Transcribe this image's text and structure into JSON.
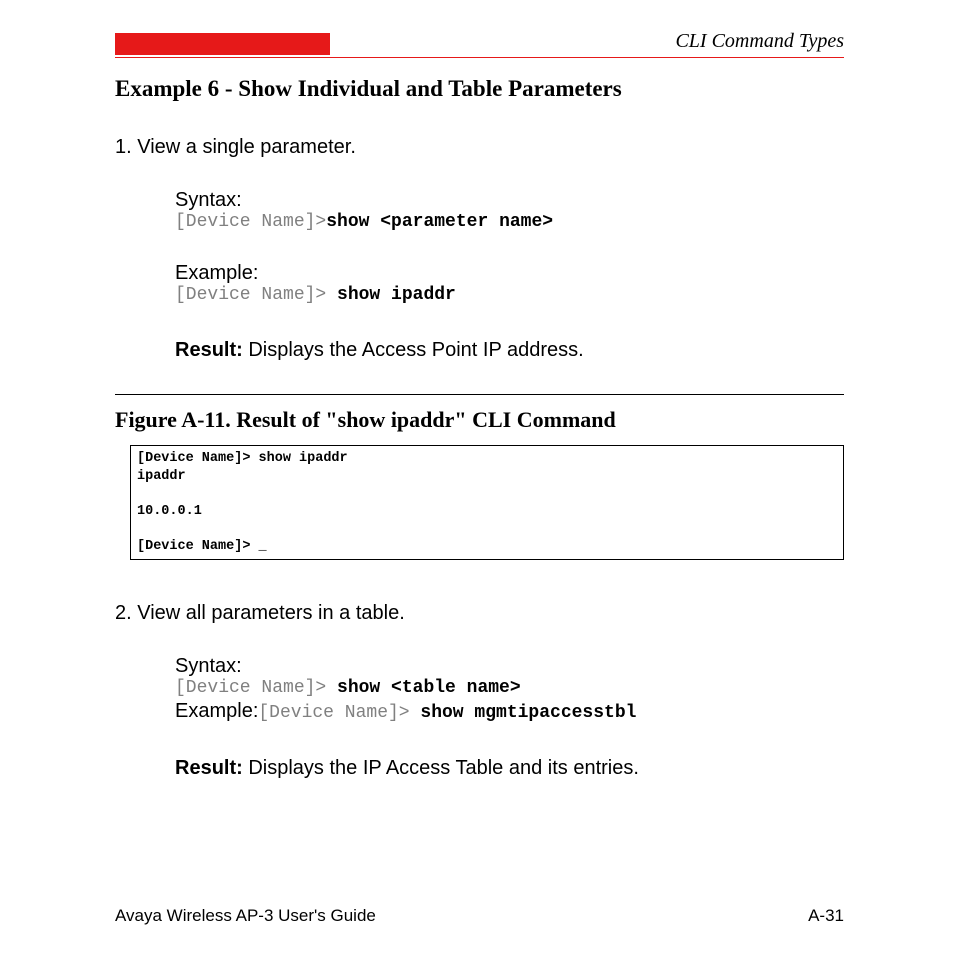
{
  "header": {
    "title": "CLI Command Types"
  },
  "heading": "Example 6 - Show Individual and Table Parameters",
  "step1": {
    "text": "1. View a single parameter.",
    "syntax_label": "Syntax:",
    "syntax_prompt": "[Device Name]>",
    "syntax_cmd": "show <parameter name>",
    "example_label": "Example:",
    "example_prompt": "[Device Name]> ",
    "example_cmd": "show ipaddr",
    "result_label": "Result:",
    "result_text": " Displays the Access Point IP address."
  },
  "figure": {
    "caption": "Figure A-11.   Result of \"show ipaddr\" CLI Command",
    "line1": "[Device Name]> show ipaddr",
    "line2": "ipaddr",
    "line3": "10.0.0.1",
    "line4": "[Device Name]> _"
  },
  "step2": {
    "text": "2. View all parameters in a table.",
    "syntax_label": "Syntax:",
    "syntax_prompt": "[Device Name]> ",
    "syntax_cmd": "show <table name>",
    "example_label": "Example:",
    "example_prompt": "[Device Name]> ",
    "example_cmd": "show mgmtipaccesstbl",
    "result_label": "Result:",
    "result_text": " Displays the IP Access Table and its entries."
  },
  "footer": {
    "left": "Avaya Wireless AP-3 User's Guide",
    "right": "A-31"
  }
}
